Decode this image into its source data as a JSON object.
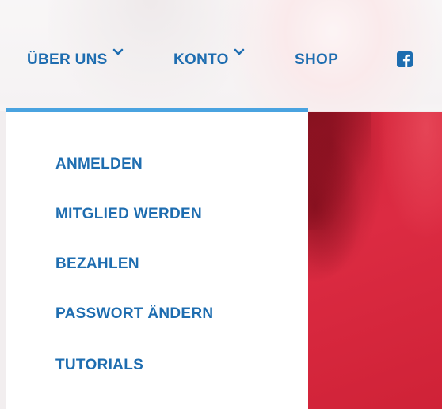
{
  "nav": {
    "items": [
      {
        "label": "ÜBER UNS",
        "has_dropdown": true
      },
      {
        "label": "KONTO",
        "has_dropdown": true
      },
      {
        "label": "SHOP",
        "has_dropdown": false
      }
    ],
    "social_icon": "facebook-icon",
    "accent_color": "#1e6db0",
    "rule_color": "#4aa3e0"
  },
  "dropdown": {
    "items": [
      {
        "label": "ANMELDEN"
      },
      {
        "label": "MITGLIED WERDEN"
      },
      {
        "label": "BEZAHLEN"
      },
      {
        "label": "PASSWORT ÄNDERN"
      },
      {
        "label": "TUTORIALS"
      }
    ]
  },
  "background": {
    "hero_color": "#d5283d"
  }
}
